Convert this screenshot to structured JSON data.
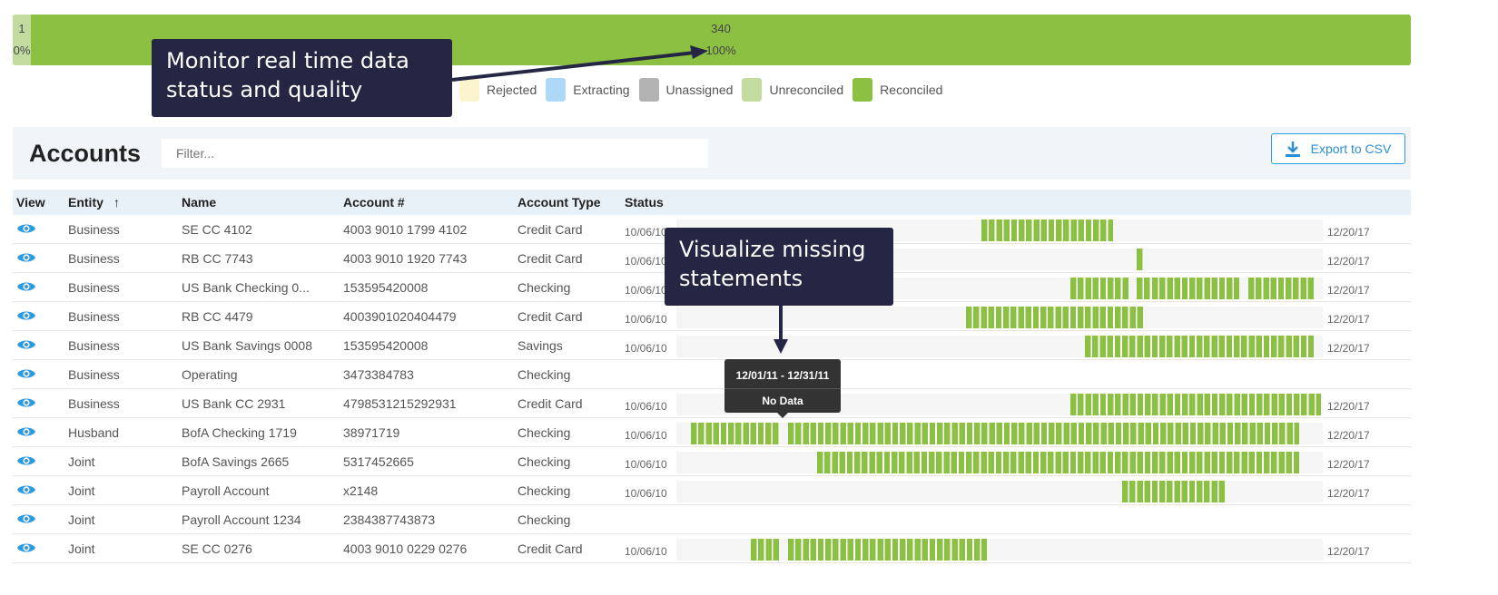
{
  "summary": {
    "segments": [
      {
        "count": "1",
        "percent": "0%",
        "color": "#c2dca0",
        "share": 0.3
      },
      {
        "count": "340",
        "percent": "100%",
        "color": "#8bc043",
        "share": 99.7
      }
    ]
  },
  "legend": [
    {
      "label": "Rejected",
      "color": "#fbf4cf"
    },
    {
      "label": "Extracting",
      "color": "#aed8f7"
    },
    {
      "label": "Unassigned",
      "color": "#b3b3b3"
    },
    {
      "label": "Unreconciled",
      "color": "#c2dca0"
    },
    {
      "label": "Reconciled",
      "color": "#8bc043"
    }
  ],
  "callouts": {
    "top": "Monitor real time data status and quality",
    "mid": "Visualize missing statements"
  },
  "accounts": {
    "title": "Accounts",
    "filter_placeholder": "Filter...",
    "export_label": "Export to CSV"
  },
  "columns": {
    "view": "View",
    "entity": "Entity",
    "entity_sort": "↑",
    "name": "Name",
    "account": "Account #",
    "type": "Account Type",
    "status": "Status"
  },
  "timeline": {
    "total_months": 87
  },
  "rows": [
    {
      "entity": "Business",
      "name": "SE CC 4102",
      "account": "4003 9010 1799 4102",
      "type": "Credit Card",
      "start": "10/06/10",
      "end": "12/20/17",
      "segments": [
        [
          41,
          58
        ]
      ]
    },
    {
      "entity": "Business",
      "name": "RB CC 7743",
      "account": "4003 9010 1920 7743",
      "type": "Credit Card",
      "start": "10/06/10",
      "end": "12/20/17",
      "segments": [
        [
          62,
          62
        ]
      ]
    },
    {
      "entity": "Business",
      "name": "US Bank Checking 0...",
      "account": "153595420008",
      "type": "Checking",
      "start": "10/06/10",
      "end": "12/20/17",
      "segments": [
        [
          53,
          57
        ],
        [
          58,
          60
        ],
        [
          62,
          63
        ],
        [
          64,
          75
        ],
        [
          77,
          85
        ]
      ]
    },
    {
      "entity": "Business",
      "name": "RB CC 4479",
      "account": "4003901020404479",
      "type": "Credit Card",
      "start": "10/06/10",
      "end": "12/20/17",
      "segments": [
        [
          39,
          62
        ]
      ]
    },
    {
      "entity": "Business",
      "name": "US Bank Savings 0008",
      "account": "153595420008",
      "type": "Savings",
      "start": "10/06/10",
      "end": "12/20/17",
      "segments": [
        [
          55,
          85
        ]
      ]
    },
    {
      "entity": "Business",
      "name": "Operating",
      "account": "3473384783",
      "type": "Checking",
      "start": null,
      "end": null,
      "segments": []
    },
    {
      "entity": "Business",
      "name": "US Bank CC 2931",
      "account": "4798531215292931",
      "type": "Credit Card",
      "start": "10/06/10",
      "end": "12/20/17",
      "segments": [
        [
          53,
          86
        ]
      ]
    },
    {
      "entity": "Husband",
      "name": "BofA Checking 1719",
      "account": "38971719",
      "type": "Checking",
      "start": "10/06/10",
      "end": "12/20/17",
      "segments": [
        [
          2,
          13
        ],
        [
          15,
          83
        ]
      ]
    },
    {
      "entity": "Joint",
      "name": "BofA Savings 2665",
      "account": "5317452665",
      "type": "Checking",
      "start": "10/06/10",
      "end": "12/20/17",
      "segments": [
        [
          19,
          83
        ]
      ]
    },
    {
      "entity": "Joint",
      "name": "Payroll Account",
      "account": "x2148",
      "type": "Checking",
      "start": "10/06/10",
      "end": "12/20/17",
      "segments": [
        [
          60,
          73
        ]
      ]
    },
    {
      "entity": "Joint",
      "name": "Payroll Account 1234",
      "account": "2384387743873",
      "type": "Checking",
      "start": null,
      "end": null,
      "segments": []
    },
    {
      "entity": "Joint",
      "name": "SE CC 0276",
      "account": "4003 9010 0229 0276",
      "type": "Credit Card",
      "start": "10/06/10",
      "end": "12/20/17",
      "segments": [
        [
          10,
          13
        ],
        [
          15,
          41
        ]
      ]
    }
  ],
  "tooltip": {
    "range": "12/01/11 - 12/31/11",
    "status": "No Data"
  }
}
